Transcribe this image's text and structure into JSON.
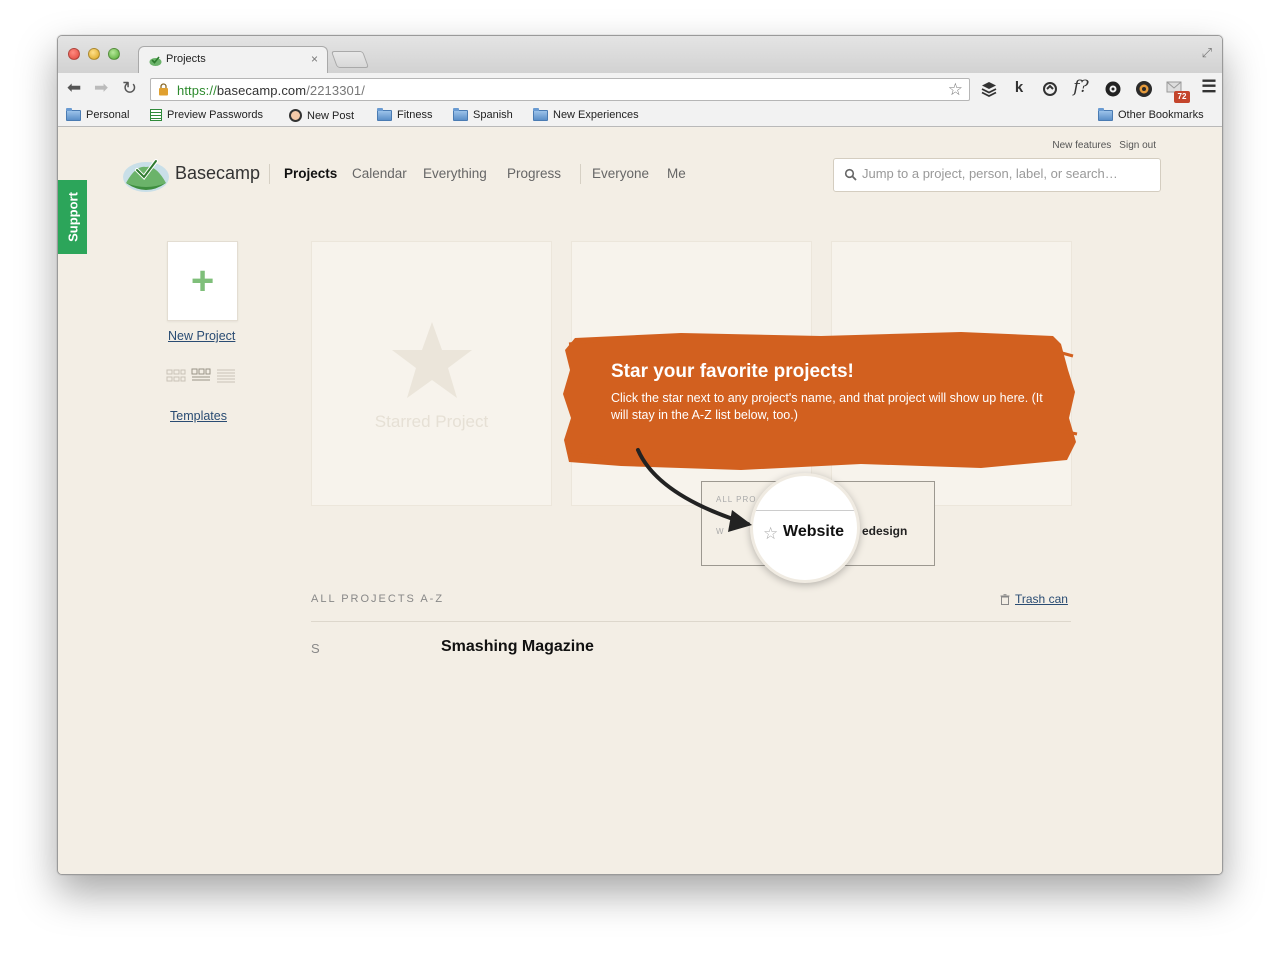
{
  "browser": {
    "tab_title": "Projects",
    "tab_close": "×",
    "url_scheme": "https://",
    "url_host": "basecamp.com",
    "url_path": "/2213301/",
    "extensions": [
      "buffer-icon",
      "k",
      "sync-icon",
      "f?",
      "gear-icon",
      "camera-icon"
    ],
    "ext_k": "k",
    "ext_f": "f?",
    "badge_count": "72",
    "bookmarks": [
      {
        "label": "Personal",
        "icon": "folder-icon"
      },
      {
        "label": "Preview Passwords",
        "icon": "sheet-icon"
      },
      {
        "label": "New Post",
        "icon": "post-icon"
      },
      {
        "label": "Fitness",
        "icon": "folder-icon"
      },
      {
        "label": "Spanish",
        "icon": "folder-icon"
      },
      {
        "label": "New Experiences",
        "icon": "folder-icon"
      }
    ],
    "other_bookmarks": "Other Bookmarks"
  },
  "app": {
    "support_label": "Support",
    "top_links": {
      "new_features": "New features",
      "sign_out": "Sign out"
    },
    "logo_text": "Basecamp",
    "nav": {
      "projects": "Projects",
      "calendar": "Calendar",
      "everything": "Everything",
      "progress": "Progress",
      "everyone": "Everyone",
      "me": "Me"
    },
    "search_placeholder": "Jump to a project, person, label, or search…",
    "new_project_label": "New Project",
    "templates_label": "Templates",
    "starred_placeholder": "Starred Project",
    "tip": {
      "title": "Star your favorite projects!",
      "body": "Click the star next to any project's name, and that project will show up here. (It will stay in the A-Z list below, too.)"
    },
    "preview": {
      "heading": "ALL PRO",
      "row_initial": "W",
      "word": "Website",
      "rest": "edesign",
      "star": "☆"
    },
    "section_title": "ALL PROJECTS A-Z",
    "trash_label": "Trash can",
    "projects": [
      {
        "letter": "S",
        "name": "Smashing Magazine"
      }
    ],
    "colors": {
      "accent_green": "#2ca55a",
      "banner_orange": "#d2601f",
      "link": "#2a4c73"
    }
  }
}
